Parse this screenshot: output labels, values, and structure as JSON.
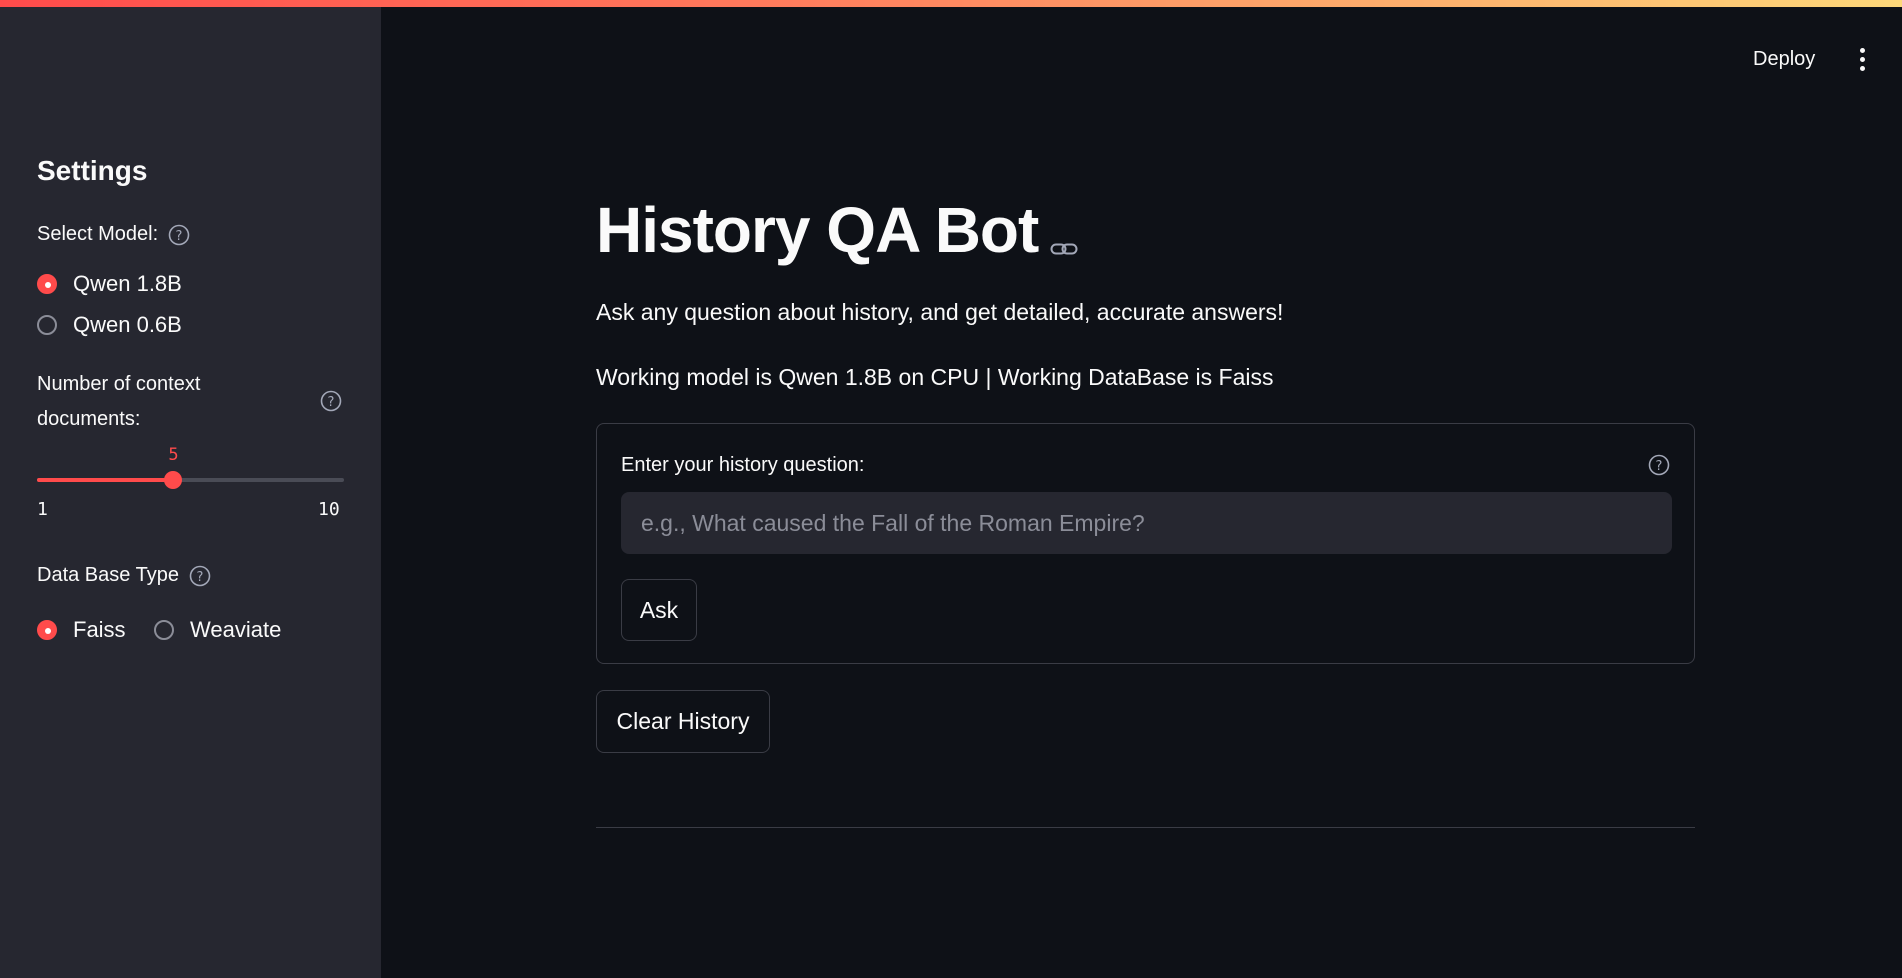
{
  "sidebar": {
    "title": "Settings",
    "model_select": {
      "label": "Select Model:",
      "options": [
        "Qwen 1.8B",
        "Qwen 0.6B"
      ],
      "selected": "Qwen 1.8B"
    },
    "context_slider": {
      "label_line1": "Number of context",
      "label_line2": "documents:",
      "value": "5",
      "min": "1",
      "max": "10"
    },
    "db_select": {
      "label": "Data Base Type",
      "options": [
        "Faiss",
        "Weaviate"
      ],
      "selected": "Faiss"
    }
  },
  "header": {
    "deploy_label": "Deploy"
  },
  "main": {
    "title": "History QA Bot",
    "description": "Ask any question about history, and get detailed, accurate answers!",
    "status": "Working model is Qwen 1.8B on CPU | Working DataBase is Faiss",
    "form": {
      "label": "Enter your history question:",
      "placeholder": "e.g., What caused the Fall of the Roman Empire?",
      "value": "",
      "ask_label": "Ask"
    },
    "clear_label": "Clear History"
  },
  "colors": {
    "accent": "#ff4b4b",
    "background": "#0e1117",
    "sidebar": "#262730"
  }
}
